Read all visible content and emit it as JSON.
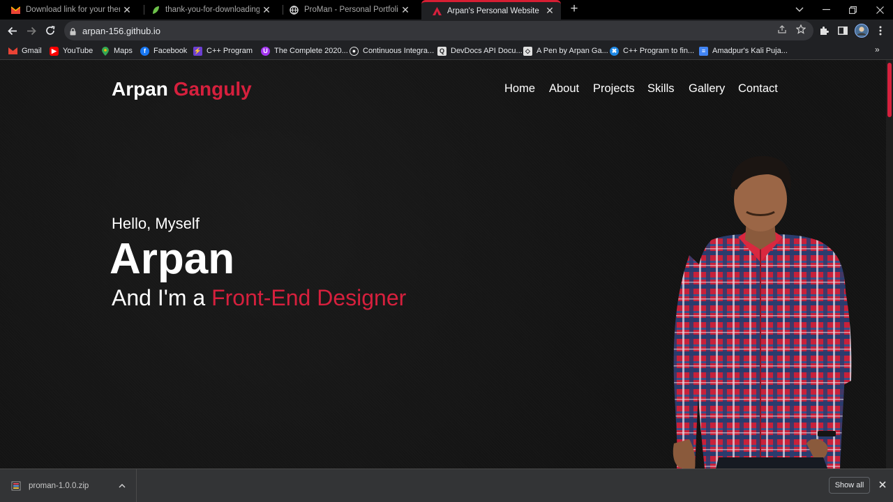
{
  "browser": {
    "tabs": [
      {
        "title": "Download link for your theme is",
        "favicon": "gmail-icon"
      },
      {
        "title": "thank-you-for-downloading - Th",
        "favicon": "leaf-icon"
      },
      {
        "title": "ProMan - Personal Portfolio HTM",
        "favicon": "globe-icon"
      },
      {
        "title": "Arpan's Personal Website",
        "favicon": "site-icon",
        "active": true
      }
    ],
    "url": "arpan-156.github.io",
    "bookmarks": [
      {
        "label": "Gmail",
        "icon": "gmail-icon"
      },
      {
        "label": "YouTube",
        "icon": "youtube-icon"
      },
      {
        "label": "Maps",
        "icon": "maps-icon"
      },
      {
        "label": "Facebook",
        "icon": "facebook-icon"
      },
      {
        "label": "C++ Program",
        "icon": "cpp-icon"
      },
      {
        "label": "The Complete 2020...",
        "icon": "udemy-icon"
      },
      {
        "label": "Continuous Integra...",
        "icon": "ci-icon"
      },
      {
        "label": "DevDocs API Docu...",
        "icon": "devdocs-icon"
      },
      {
        "label": "A Pen by Arpan Ga...",
        "icon": "codepen-icon"
      },
      {
        "label": "C++ Program to fin...",
        "icon": "cpp-icon"
      },
      {
        "label": "Amadpur's Kali Puja...",
        "icon": "docs-icon"
      }
    ]
  },
  "site": {
    "logo_first": "Arpan",
    "logo_last": "Ganguly",
    "nav": [
      "Home",
      "About",
      "Projects",
      "Skills",
      "Gallery",
      "Contact"
    ],
    "greeting": "Hello, Myself",
    "name": "Arpan",
    "role_prefix": "And I'm a",
    "role": "Front-End Designer",
    "accent_color": "#d6203d"
  },
  "downloads": {
    "file": "proman-1.0.0.zip",
    "show_all": "Show all"
  }
}
